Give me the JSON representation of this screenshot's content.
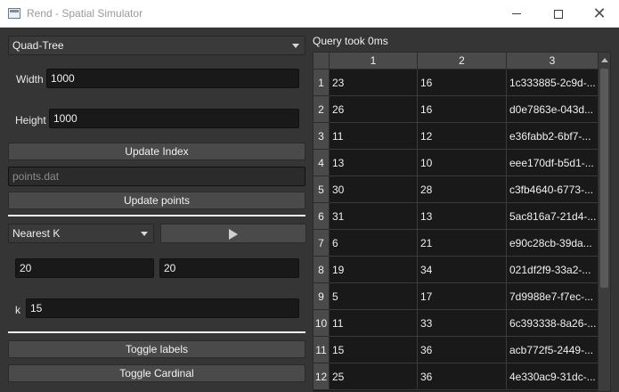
{
  "window": {
    "title": "Rend - Spatial Simulator",
    "minimize": "",
    "maximize": "",
    "close": "✕"
  },
  "index_panel": {
    "index_type": "Quad-Tree",
    "width_label": "Width",
    "width_value": "1000",
    "height_label": "Height",
    "height_value": "1000",
    "update_index_label": "Update Index",
    "points_file_placeholder": "points.dat",
    "update_points_label": "Update points"
  },
  "query_panel": {
    "query_type": "Nearest K",
    "x_value": "20",
    "y_value": "20",
    "k_label": "k",
    "k_value": "15",
    "toggle_labels_label": "Toggle labels",
    "toggle_cardinal_label": "Toggle Cardinal"
  },
  "results": {
    "status": "Query took 0ms",
    "columns": [
      "1",
      "2",
      "3"
    ],
    "rows": [
      {
        "index": "1",
        "c1": "23",
        "c2": "16",
        "c3": "1c333885-2c9d-..."
      },
      {
        "index": "2",
        "c1": "26",
        "c2": "16",
        "c3": "d0e7863e-043d..."
      },
      {
        "index": "3",
        "c1": "11",
        "c2": "12",
        "c3": "e36fabb2-6bf7-..."
      },
      {
        "index": "4",
        "c1": "13",
        "c2": "10",
        "c3": "eee170df-b5d1-..."
      },
      {
        "index": "5",
        "c1": "30",
        "c2": "28",
        "c3": "c3fb4640-6773-..."
      },
      {
        "index": "6",
        "c1": "31",
        "c2": "13",
        "c3": "5ac816a7-21d4-..."
      },
      {
        "index": "7",
        "c1": "6",
        "c2": "21",
        "c3": "e90c28cb-39da..."
      },
      {
        "index": "8",
        "c1": "19",
        "c2": "34",
        "c3": "021df2f9-33a2-..."
      },
      {
        "index": "9",
        "c1": "5",
        "c2": "17",
        "c3": "7d9988e7-f7ec-..."
      },
      {
        "index": "10",
        "c1": "11",
        "c2": "33",
        "c3": "6c393338-8a26-..."
      },
      {
        "index": "11",
        "c1": "15",
        "c2": "36",
        "c3": "acb772f5-2449-..."
      },
      {
        "index": "12",
        "c1": "25",
        "c2": "36",
        "c3": "4e330ac9-31dc-..."
      }
    ]
  }
}
